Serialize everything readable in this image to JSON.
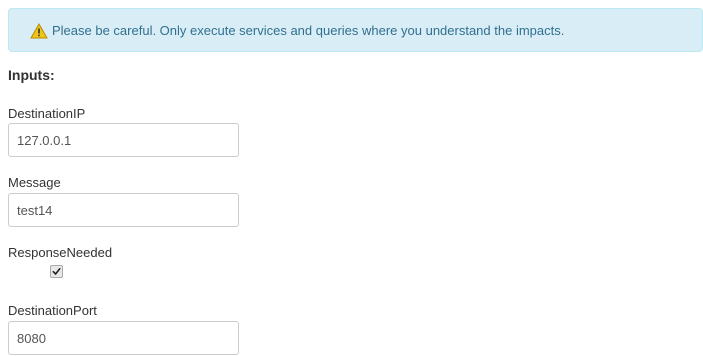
{
  "alert": {
    "icon": "warning-icon",
    "message": "Please be careful. Only execute services and queries where you understand the impacts."
  },
  "inputs": {
    "heading": "Inputs:",
    "destination_ip": {
      "label": "DestinationIP",
      "value": "127.0.0.1"
    },
    "message": {
      "label": "Message",
      "value": "test14"
    },
    "response_needed": {
      "label": "ResponseNeeded",
      "checked": true
    },
    "destination_port": {
      "label": "DestinationPort",
      "value": "8080"
    }
  },
  "colors": {
    "alert_background": "#d9edf7",
    "alert_border": "#bce8f1",
    "alert_text": "#31708f",
    "warning_icon_fill": "#f0c419",
    "input_border": "#cccccc"
  }
}
